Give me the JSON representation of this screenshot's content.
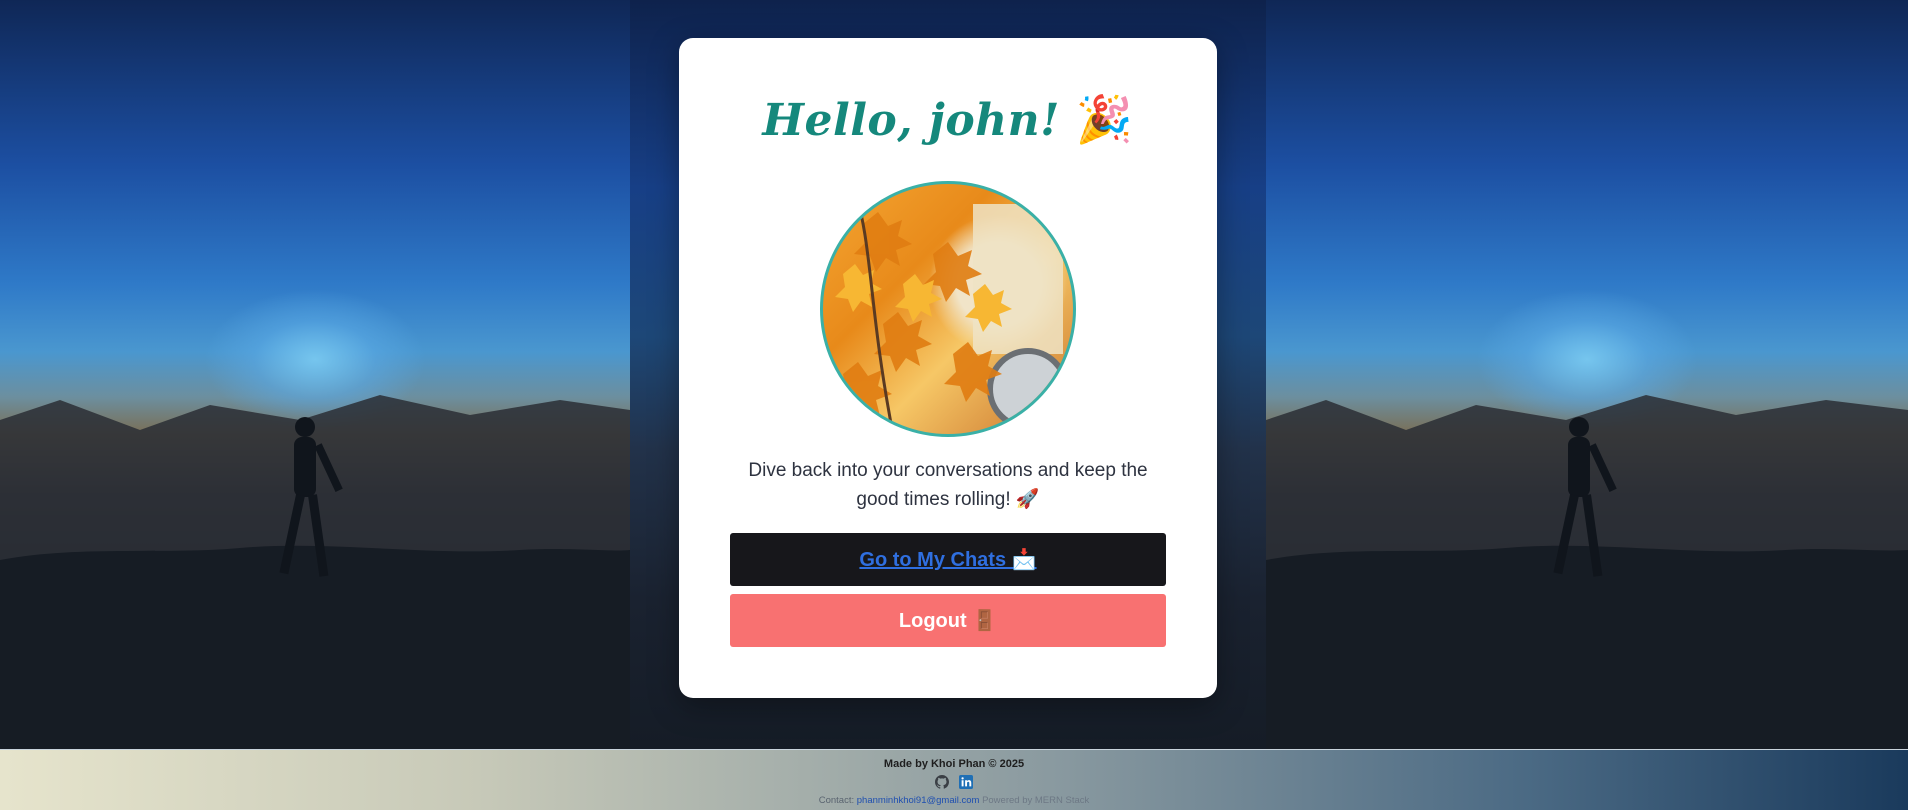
{
  "card": {
    "greeting": "Hello, john!",
    "greeting_emoji": "🎉",
    "tagline": "Dive back into your conversations and keep the good times rolling! 🚀",
    "chats_button": "Go to My Chats 📩",
    "logout_button": "Logout 🚪"
  },
  "footer": {
    "made_by": "Made by Khoi Phan © 2025",
    "icons": [
      "github-icon",
      "linkedin-icon"
    ],
    "contact_label": "Contact:",
    "contact_email": "phanminhkhoi91@gmail.com",
    "powered_by": "Powered by MERN Stack"
  },
  "colors": {
    "greeting": "#15887c",
    "chats_button_bg": "#17171b",
    "chats_link": "#2f6fe0",
    "logout_bg": "#f87171"
  }
}
